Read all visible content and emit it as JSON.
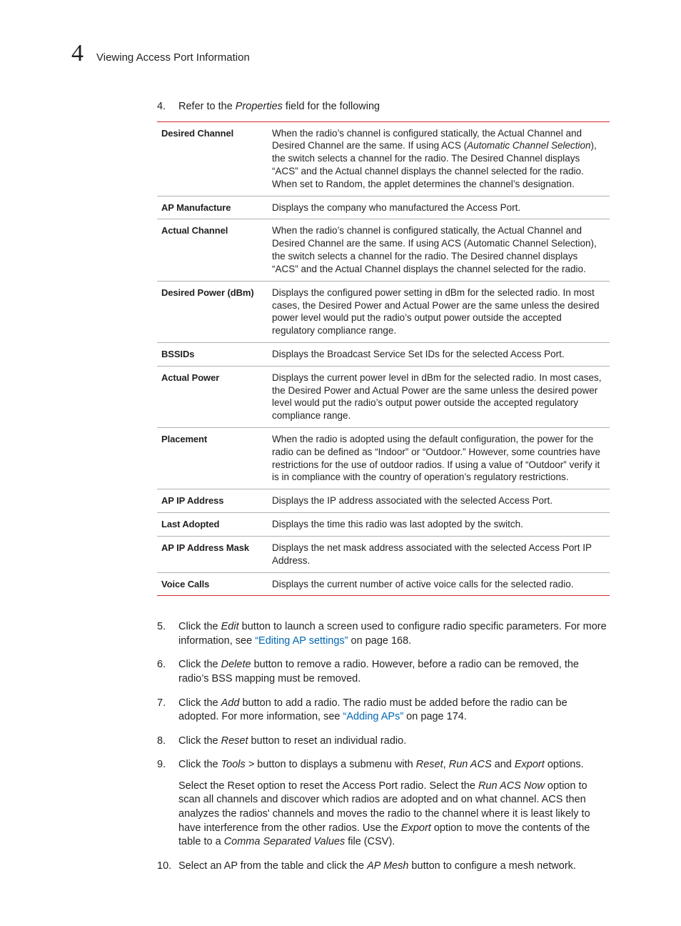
{
  "header": {
    "chapter_number": "4",
    "chapter_title": "Viewing Access Port Information"
  },
  "steps": {
    "s4": {
      "num": "4.",
      "lead": "Refer to the ",
      "em1": "Properties",
      "tail": " field for the following"
    },
    "s5": {
      "num": "5.",
      "p1a": "Click the ",
      "p1em": "Edit",
      "p1b": " button to launch a screen used to configure radio specific parameters. For more information, see ",
      "link": "“Editing AP settings”",
      "p1c": " on page 168."
    },
    "s6": {
      "num": "6.",
      "a": "Click the ",
      "em": "Delete",
      "b": " button to remove a radio. However, before a radio can be removed, the radio’s BSS mapping must be removed."
    },
    "s7": {
      "num": "7.",
      "a": "Click the ",
      "em": "Add",
      "b": " button to add a radio. The radio must be added before the radio can be adopted. For more information, see ",
      "link": "“Adding APs”",
      "c": " on page 174."
    },
    "s8": {
      "num": "8.",
      "a": "Click the ",
      "em": "Reset",
      "b": " button to reset an individual radio."
    },
    "s9": {
      "num": "9.",
      "p1a": "Click the ",
      "p1em": "Tools >",
      "p1b": " button to displays a submenu with ",
      "p1em2": "Reset",
      "p1c": ", ",
      "p1em3": "Run ACS",
      "p1d": " and ",
      "p1em4": "Export",
      "p1e": " options.",
      "p2a": "Select the Reset option to reset the Access Port radio. Select the ",
      "p2em1": "Run ACS Now",
      "p2b": " option to scan all channels and discover which radios are adopted and on what channel. ACS then analyzes the radios' channels and moves the radio to the channel where it is least likely to have interference from the other radios. Use the ",
      "p2em2": "Export",
      "p2c": " option to move the contents of the table to a ",
      "p2em3": "Comma Separated Values",
      "p2d": " file (CSV)."
    },
    "s10": {
      "num": "10.",
      "a": "Select an AP from the table and click the ",
      "em": "AP Mesh",
      "b": " button to configure a mesh network."
    }
  },
  "properties_table": [
    {
      "term": "Desired Channel",
      "desc_pre": "When the radio’s channel is configured statically, the Actual Channel and Desired Channel are the same. If using ACS (",
      "desc_em": "Automatic Channel Selection",
      "desc_post": "), the switch selects a channel for the radio. The Desired Channel displays “ACS” and the Actual channel displays the channel selected for the radio. When set to Random, the applet determines the channel’s designation."
    },
    {
      "term": "AP Manufacture",
      "desc": "Displays the company who manufactured the Access Port."
    },
    {
      "term": "Actual Channel",
      "desc": "When the radio’s channel is configured statically, the Actual Channel and Desired Channel are the same. If using ACS (Automatic Channel Selection), the switch selects a channel for the radio. The Desired channel displays “ACS” and the Actual Channel displays the channel selected for the radio."
    },
    {
      "term": "Desired Power (dBm)",
      "desc": "Displays the configured power setting in dBm for the selected radio. In most cases, the Desired Power and Actual Power are the same unless the desired power level would put the radio’s output power outside the accepted regulatory compliance range."
    },
    {
      "term": "BSSIDs",
      "desc": "Displays the Broadcast Service Set IDs for the selected Access Port."
    },
    {
      "term": "Actual Power",
      "desc": "Displays the current power level in dBm for the selected radio. In most cases, the Desired Power and Actual Power are the same unless the desired power level would put the radio’s output power outside the accepted regulatory compliance range."
    },
    {
      "term": "Placement",
      "desc": "When the radio is adopted using the default configuration, the power for the radio can be defined as “Indoor” or “Outdoor.” However, some countries have restrictions for the use of outdoor radios. If using a value of “Outdoor” verify it is in compliance with the country of operation’s regulatory restrictions."
    },
    {
      "term": "AP IP Address",
      "desc": "Displays the IP address associated with the selected Access Port."
    },
    {
      "term": "Last Adopted",
      "desc": "Displays the time this radio was last adopted by the switch."
    },
    {
      "term": "AP IP Address Mask",
      "desc": "Displays the net mask address associated with the selected Access Port IP Address."
    },
    {
      "term": "Voice Calls",
      "desc": "Displays the current number of active voice calls for the selected radio."
    }
  ]
}
